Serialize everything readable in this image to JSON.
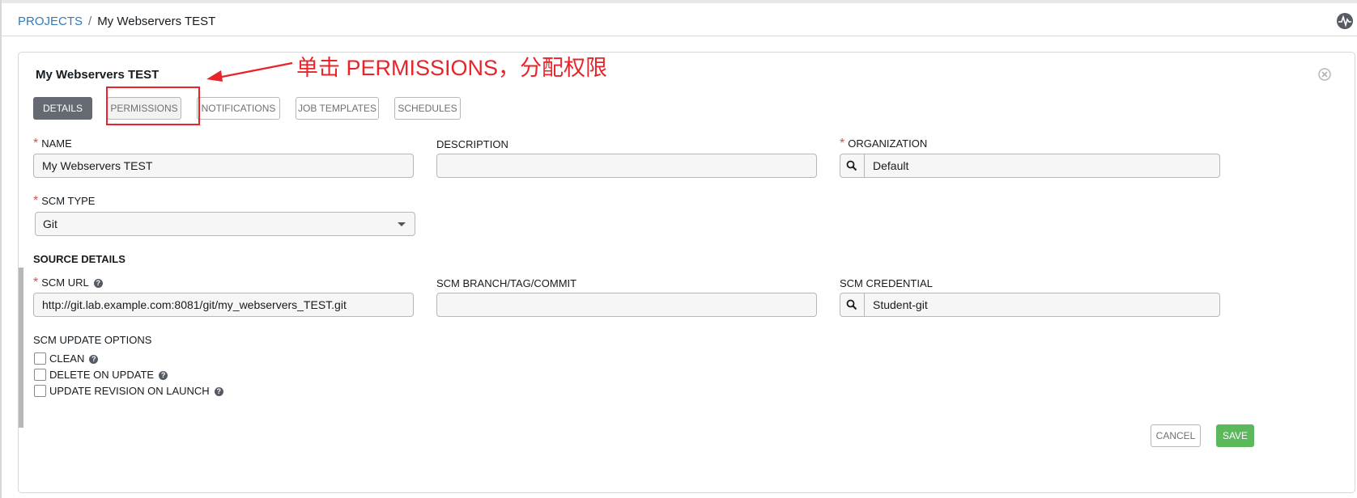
{
  "breadcrumb": {
    "projects_label": "PROJECTS",
    "separator": "/",
    "current": "My Webservers TEST"
  },
  "header": {
    "activity_icon": "activity-stream-icon"
  },
  "card": {
    "title": "My Webservers TEST",
    "close_icon": "close-circle-icon"
  },
  "tabs": [
    {
      "label": "DETAILS",
      "active": true
    },
    {
      "label": "PERMISSIONS",
      "active": false
    },
    {
      "label": "NOTIFICATIONS",
      "active": false
    },
    {
      "label": "JOB TEMPLATES",
      "active": false
    },
    {
      "label": "SCHEDULES",
      "active": false
    }
  ],
  "annotation": {
    "text": "单击 PERMISSIONS，分配权限",
    "color": "#e8242a"
  },
  "form": {
    "name": {
      "label": "NAME",
      "value": "My Webservers TEST",
      "required": true
    },
    "description": {
      "label": "DESCRIPTION",
      "value": ""
    },
    "organization": {
      "label": "ORGANIZATION",
      "value": "Default",
      "required": true
    },
    "scm_type": {
      "label": "SCM TYPE",
      "value": "Git",
      "required": true
    },
    "source_details": "SOURCE DETAILS",
    "scm_url": {
      "label": "SCM URL",
      "value": "http://git.lab.example.com:8081/git/my_webservers_TEST.git",
      "required": true
    },
    "scm_branch": {
      "label": "SCM BRANCH/TAG/COMMIT",
      "value": ""
    },
    "scm_credential": {
      "label": "SCM CREDENTIAL",
      "value": "Student-git"
    },
    "update_options": {
      "label": "SCM UPDATE OPTIONS",
      "items": [
        {
          "label": "CLEAN",
          "checked": false
        },
        {
          "label": "DELETE ON UPDATE",
          "checked": false
        },
        {
          "label": "UPDATE REVISION ON LAUNCH",
          "checked": false
        }
      ]
    }
  },
  "actions": {
    "cancel": "CANCEL",
    "save": "SAVE"
  },
  "colors": {
    "link": "#337ab7",
    "active_tab": "#646972",
    "required": "#d9534f",
    "save": "#5cb85c"
  }
}
